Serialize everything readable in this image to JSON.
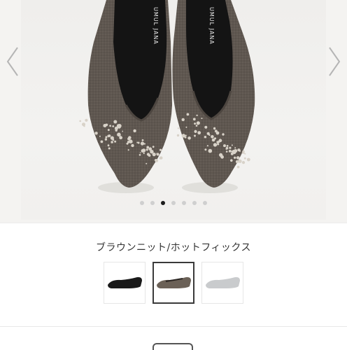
{
  "gallery": {
    "brand_text": "UMUL JANA",
    "prev_icon": "chevron-left-icon",
    "next_icon": "chevron-right-icon",
    "dot_count": 7,
    "active_dot_index": 2
  },
  "product": {
    "color_name": "ブラウンニット/ホットフィックス"
  },
  "swatches": [
    {
      "color": "black",
      "hex": "#1a1a1a",
      "selected": false
    },
    {
      "color": "brown",
      "hex": "#6b6157",
      "selected": true
    },
    {
      "color": "light-gray",
      "hex": "#c9cbcd",
      "selected": false
    }
  ],
  "colors": {
    "shoe_knit": "#5f5750",
    "shoe_lining": "#141414",
    "active_dot": "#1b1b1b",
    "inactive_dot": "#cfcfcf"
  }
}
